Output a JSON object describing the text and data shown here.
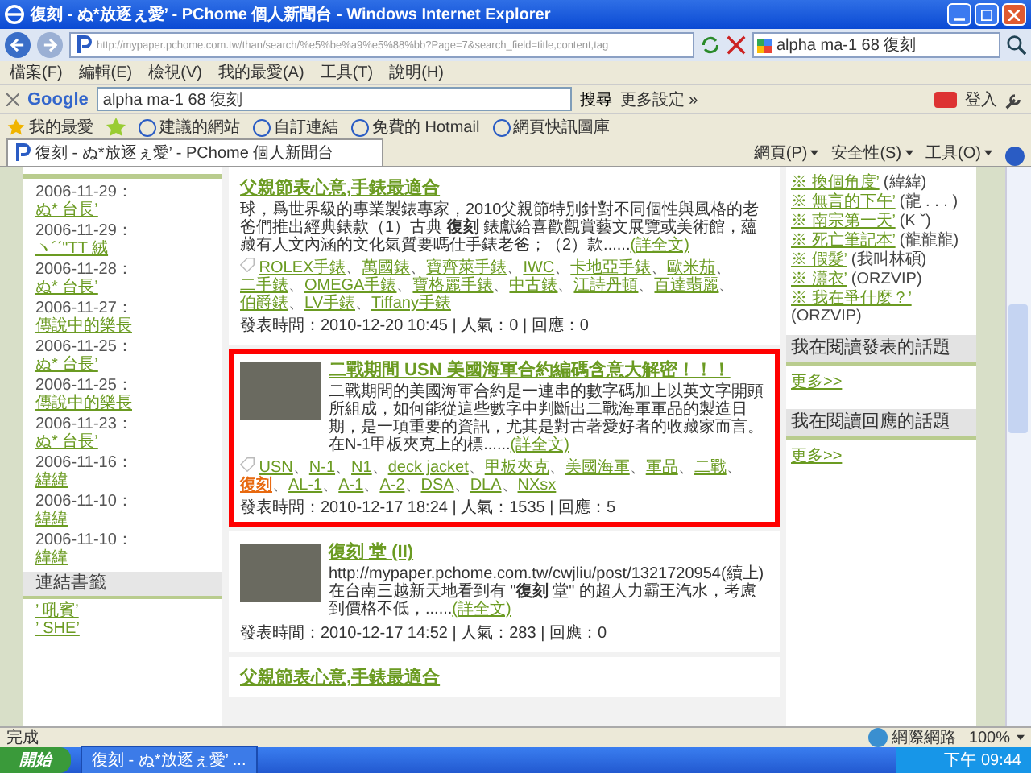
{
  "window": {
    "title": "復刻 - ぬ*放逐ぇ愛’ - PChome 個人新聞台 - Windows Internet Explorer"
  },
  "address_bar": {
    "url": "http://mypaper.pchome.com.tw/than/search/%e5%be%a9%e5%88%bb?Page=7&search_field=title,content,tag",
    "search_value": "alpha ma-1 68 復刻"
  },
  "menu_bar": [
    "檔案(F)",
    "編輯(E)",
    "檢視(V)",
    "我的最愛(A)",
    "工具(T)",
    "說明(H)"
  ],
  "google_toolbar": {
    "logo": "Google",
    "search_value": "alpha ma-1 68 復刻",
    "search_button": "搜尋",
    "more": "更多設定 »",
    "sign_in": "登入"
  },
  "favorites_bar": {
    "label": "我的最愛",
    "links": [
      "建議的網站",
      "自訂連結",
      "免費的 Hotmail",
      "網頁快訊圖庫"
    ]
  },
  "tab": {
    "title": "復刻 - ぬ*放逐ぇ愛’ - PChome 個人新聞台"
  },
  "command_bar": [
    "網頁(P)",
    "安全性(S)",
    "工具(O)"
  ],
  "sidebar_left": {
    "entries": [
      {
        "date": "2006-11-29：",
        "author": "ぬ* 台長’"
      },
      {
        "date": "2006-11-29：",
        "author": "ヽ´ˊ\"TT 絨"
      },
      {
        "date": "2006-11-28：",
        "author": "ぬ* 台長’"
      },
      {
        "date": "2006-11-27：",
        "author": "傳說中的樂長"
      },
      {
        "date": "2006-11-25：",
        "author": "ぬ* 台長’"
      },
      {
        "date": "2006-11-25：",
        "author": "傳說中的樂長"
      },
      {
        "date": "2006-11-23：",
        "author": "ぬ* 台長’"
      },
      {
        "date": "2006-11-16：",
        "author": "緯緯"
      },
      {
        "date": "2006-11-10：",
        "author": "緯緯"
      },
      {
        "date": "2006-11-10：",
        "author": "緯緯"
      }
    ],
    "bookmarks": {
      "heading": "連結書籤",
      "links": [
        "’ 吼賓’",
        "’ SHE’"
      ]
    }
  },
  "tag_separator": "、",
  "posts": [
    {
      "title": "父親節表心意,手錶最適合",
      "highlighted": false,
      "has_image": false,
      "body": "球，爲世界級的專業製錶專家，2010父親節特別針對不同個性與風格的老爸們推出經典錶款（1）古典 **復刻** 錶獻給喜歡觀賞藝文展覽或美術館，蘊藏有人文內涵的文化氣質要嗎仕手錶老爸；（2）款......",
      "more": "(詳全文)",
      "tags": [
        {
          "text": "ROLEX手錶",
          "highlight": false
        },
        {
          "text": "萬國錶",
          "highlight": false
        },
        {
          "text": "寶齊萊手錶",
          "highlight": false
        },
        {
          "text": "IWC",
          "highlight": false
        },
        {
          "text": "卡地亞手錶",
          "highlight": false
        },
        {
          "text": "歐米茄",
          "highlight": false
        },
        {
          "text": "二手錶",
          "highlight": false
        },
        {
          "text": "OMEGA手錶",
          "highlight": false
        },
        {
          "text": "寶格麗手錶",
          "highlight": false
        },
        {
          "text": "中古錶",
          "highlight": false
        },
        {
          "text": "江詩丹頓",
          "highlight": false
        },
        {
          "text": "百達翡麗",
          "highlight": false
        },
        {
          "text": "伯爵錶",
          "highlight": false
        },
        {
          "text": "LV手錶",
          "highlight": false
        },
        {
          "text": "Tiffany手錶",
          "highlight": false
        }
      ],
      "meta": "發表時間：2010-12-20 10:45 | 人氣：0 | 回應：0"
    },
    {
      "title": "二戰期間 USN 美國海軍合約編碼含意大解密！！！",
      "highlighted": true,
      "has_image": true,
      "body": "二戰期間的美國海軍合約是一連串的數字碼加上以英文字開頭所組成，如何能從這些數字中判斷出二戰海軍軍品的製造日期，是一項重要的資訊，尤其是對古著愛好者的收藏家而言。在N-1甲板夾克上的標......",
      "more": "(詳全文)",
      "tags": [
        {
          "text": "USN",
          "highlight": false
        },
        {
          "text": "N-1",
          "highlight": false
        },
        {
          "text": "N1",
          "highlight": false
        },
        {
          "text": "deck jacket",
          "highlight": false
        },
        {
          "text": "甲板夾克",
          "highlight": false
        },
        {
          "text": "美國海軍",
          "highlight": false
        },
        {
          "text": "軍品",
          "highlight": false
        },
        {
          "text": "二戰",
          "highlight": false
        },
        {
          "text": "復刻",
          "highlight": true
        },
        {
          "text": "AL-1",
          "highlight": false
        },
        {
          "text": "A-1",
          "highlight": false
        },
        {
          "text": "A-2",
          "highlight": false
        },
        {
          "text": "DSA",
          "highlight": false
        },
        {
          "text": "DLA",
          "highlight": false
        },
        {
          "text": "NXsx",
          "highlight": false
        }
      ],
      "meta": "發表時間：2010-12-17 18:24 | 人氣：1535 | 回應：5"
    },
    {
      "title": "**復刻** 堂 (II)",
      "highlighted": false,
      "has_image": true,
      "body": "http://mypaper.pchome.com.tw/cwjliu/post/1321720954(續上)在台南三越新天地看到有 \"**復刻** 堂\" 的超人力霸王汽水，考慮到價格不低，......",
      "more": "(詳全文)",
      "meta": "發表時間：2010-12-17 14:52 | 人氣：283 | 回應：0"
    },
    {
      "title": "父親節表心意,手錶最適合",
      "highlighted": false,
      "has_image": false
    }
  ],
  "sidebar_right": {
    "recent_replies": [
      {
        "title": "換個角度’",
        "author": "(緯緯)"
      },
      {
        "title": "無言的下午’",
        "author": "(龍 . . . )"
      },
      {
        "title": "南宗第一天’",
        "author": "(K ˇ)"
      },
      {
        "title": "死亡筆記本’",
        "author": "(龍龍龍)"
      },
      {
        "title": "假髮’",
        "author": "(我叫林碩)"
      },
      {
        "title": "瀟衣’",
        "author": "(ORZVIP)"
      },
      {
        "title": "我在爭什麼？’",
        "author": "(ORZVIP)"
      }
    ],
    "bullet": "※",
    "sections": [
      {
        "heading": "我在閱讀發表的話題",
        "more": "更多>>"
      },
      {
        "heading": "我在閱讀回應的話題",
        "more": "更多>>"
      }
    ]
  },
  "status_bar": {
    "text": "完成",
    "zone": "網際網路",
    "zoom": "100%"
  },
  "taskbar": {
    "start": "開始",
    "task": "復刻 - ぬ*放逐ぇ愛’ ...",
    "clock": "下午 09:44"
  }
}
